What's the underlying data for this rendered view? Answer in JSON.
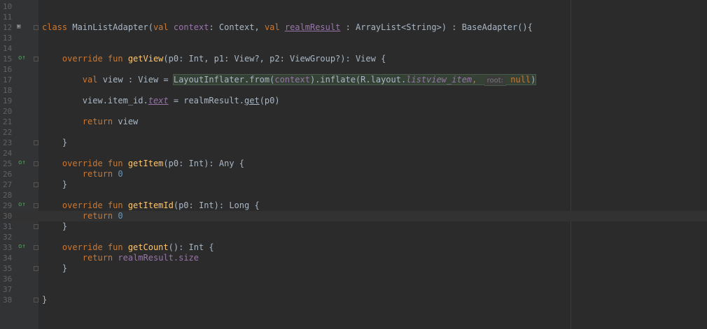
{
  "lines": [
    {
      "n": "10",
      "text": ""
    },
    {
      "n": "11",
      "text": ""
    },
    {
      "n": "12",
      "text": "class MainListAdapter(val context: Context, val realmResult : ArrayList<String>) : BaseAdapter(){"
    },
    {
      "n": "13",
      "text": ""
    },
    {
      "n": "14",
      "text": ""
    },
    {
      "n": "15",
      "text": "    override fun getView(p0: Int, p1: View?, p2: ViewGroup?): View {"
    },
    {
      "n": "16",
      "text": ""
    },
    {
      "n": "17",
      "text": "        val view : View = LayoutInflater.from(context).inflate(R.layout.listview_item, root: null)"
    },
    {
      "n": "18",
      "text": ""
    },
    {
      "n": "19",
      "text": "        view.item_id.text = realmResult.get(p0)"
    },
    {
      "n": "20",
      "text": ""
    },
    {
      "n": "21",
      "text": "        return view"
    },
    {
      "n": "22",
      "text": ""
    },
    {
      "n": "23",
      "text": "    }"
    },
    {
      "n": "24",
      "text": ""
    },
    {
      "n": "25",
      "text": "    override fun getItem(p0: Int): Any {"
    },
    {
      "n": "26",
      "text": "        return 0"
    },
    {
      "n": "27",
      "text": "    }"
    },
    {
      "n": "28",
      "text": ""
    },
    {
      "n": "29",
      "text": "    override fun getItemId(p0: Int): Long {"
    },
    {
      "n": "30",
      "text": "        return 0"
    },
    {
      "n": "31",
      "text": "    }"
    },
    {
      "n": "32",
      "text": ""
    },
    {
      "n": "33",
      "text": "    override fun getCount(): Int {"
    },
    {
      "n": "34",
      "text": "        return realmResult.size"
    },
    {
      "n": "35",
      "text": "    }"
    },
    {
      "n": "36",
      "text": ""
    },
    {
      "n": "37",
      "text": ""
    },
    {
      "n": "38",
      "text": "}"
    }
  ],
  "tokens": {
    "class_kw": "class",
    "class_name": " MainListAdapter(",
    "val_kw": "val",
    "context_prop": "context",
    "colon_context": ": Context, ",
    "realm_prop": "realmResult",
    "rest12": " : ArrayList<String>) : BaseAdapter(){",
    "override_fun": "override fun ",
    "getView": "getView",
    "getView_sig": "(p0: Int, p1: View?, p2: ViewGroup?): View {",
    "val_view": "val",
    "view_decl": " view : View = ",
    "inflater": "LayoutInflater.from(",
    "ctx": "context",
    "inflate": ").inflate(R.layout.",
    "listview_item": "listview_item",
    "comma": ", ",
    "root_hint": "root:",
    "null_kw": "null",
    "close_paren": ")",
    "view_item": "view.item_id.",
    "text_prop": "text",
    "assign_get": " = realmResult.",
    "get_fn": "get",
    "p0": "(p0)",
    "return_kw": "return",
    "view_ret": " view",
    "getItem": "getItem",
    "getItem_sig": "(p0: Int): Any {",
    "zero": "0",
    "getItemId": "getItemId",
    "getItemId_sig": "(p0: Int): Long {",
    "getCount": "getCount",
    "getCount_sig": "(): Int {",
    "realm_ret": "realmResult.",
    "size_prop": "size",
    "close_brace": "}",
    "indent_close": "    }"
  }
}
